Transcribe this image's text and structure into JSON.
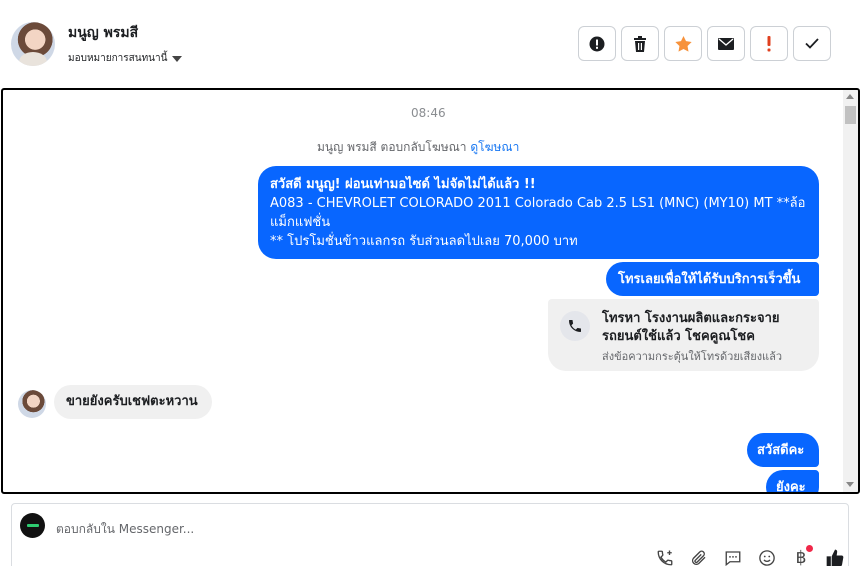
{
  "header": {
    "contact_name": "มนูญ พรมสี",
    "assign_label": "มอบหมายการสนทนานี้"
  },
  "chat": {
    "timestamp": "08:46",
    "reply_prefix": "มนูญ พรมสี ตอบกลับโฆษณา",
    "reply_link": "ดูโฆษณา",
    "messages": {
      "m1_line1": "สวัสดี มนูญ! ผ่อนเท่ามอไซด์ ไม่จัดไม่ได้แล้ว !!",
      "m1_line2": "A083 - CHEVROLET COLORADO 2011 Colorado Cab 2.5 LS1 (MNC) (MY10) MT **ล้อแม็กแฟชั่น",
      "m1_line3": "** โปรโมชั่นข้าวแลกรถ รับส่วนลดไปเลย 70,000 บาท",
      "m2": "โทรเลยเพื่อให้ได้รับบริการเร็วขึ้น",
      "call_title": "โทรหา โรงงานผลิตและกระจายรถยนต์ใช้แล้ว โชคคูณโชค",
      "call_sub": "ส่งข้อความกระตุ้นให้โทรด้วยเสียงแล้ว",
      "incoming": "ขายยังครับเชฟตะหวาน",
      "m5": "สวัสดีคะ",
      "m6": "ยังคะ"
    }
  },
  "composer": {
    "placeholder": "ตอบกลับใน Messenger..."
  },
  "colors": {
    "accent": "#0866ff",
    "star": "#f7923b",
    "danger": "#e0401f"
  }
}
